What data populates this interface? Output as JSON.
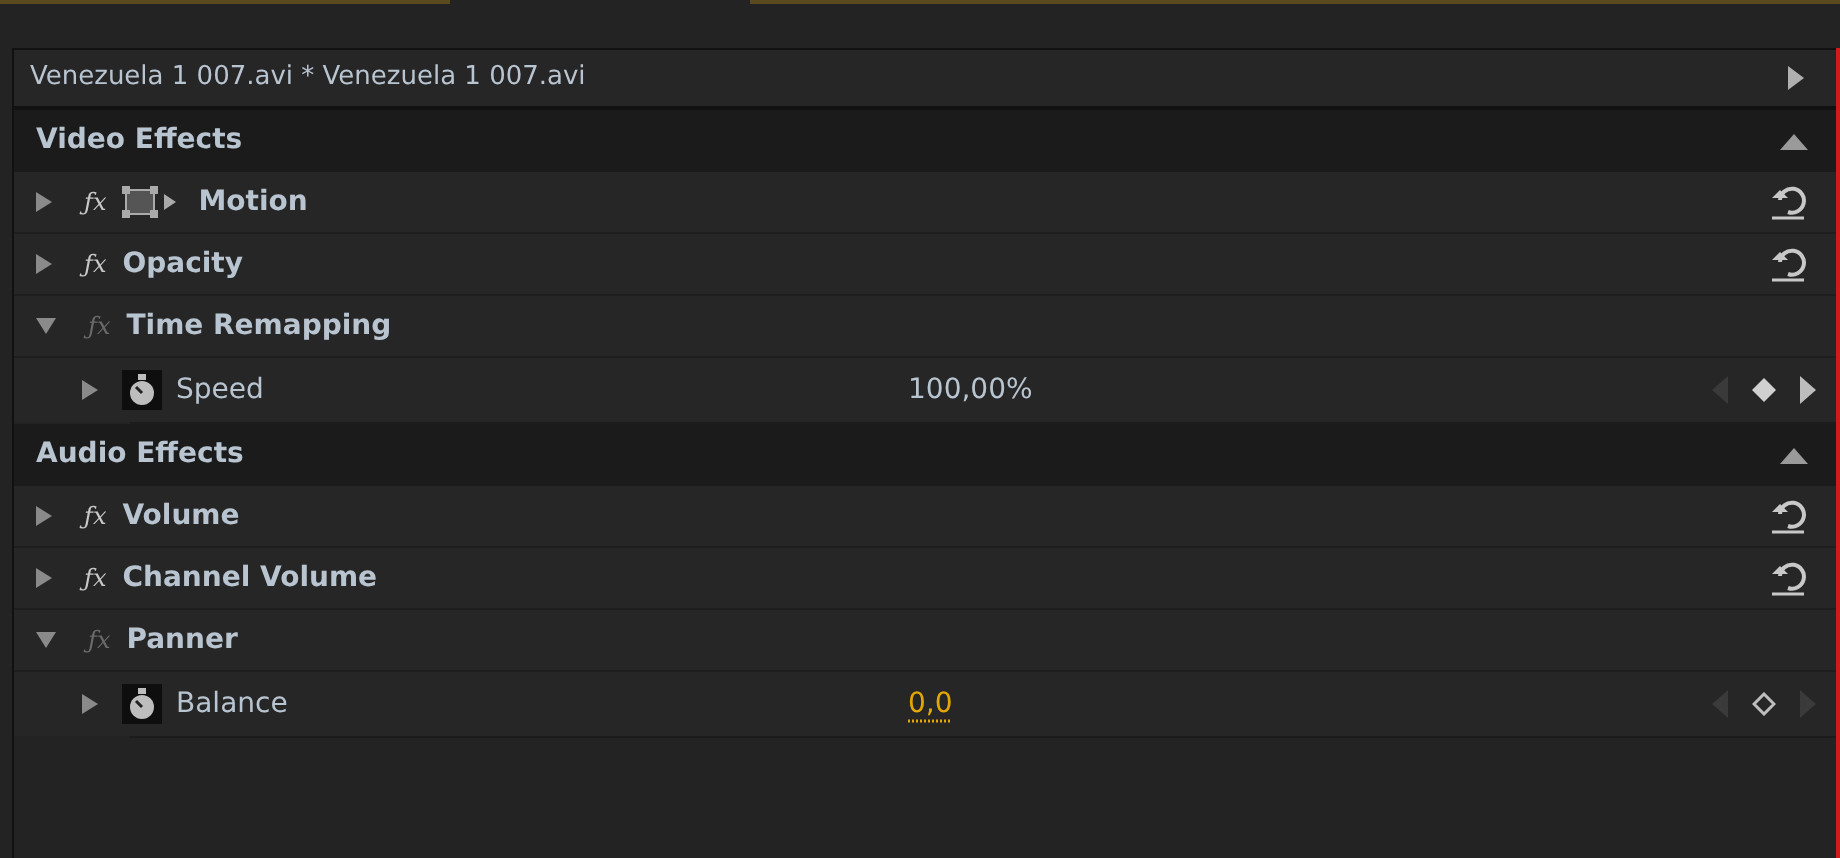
{
  "clip_header": {
    "title": "Venezuela 1 007.avi * Venezuela 1 007.avi"
  },
  "sections": [
    {
      "title": "Video Effects",
      "expanded": true,
      "effects": [
        {
          "name": "Motion",
          "fx": "ƒx",
          "expanded": false,
          "fx_enabled": true,
          "transform_icon": true,
          "resettable": true
        },
        {
          "name": "Opacity",
          "fx": "ƒx",
          "expanded": false,
          "fx_enabled": true,
          "transform_icon": false,
          "resettable": true
        },
        {
          "name": "Time Remapping",
          "fx": "ƒx",
          "expanded": true,
          "fx_enabled": false,
          "transform_icon": false,
          "resettable": false,
          "params": [
            {
              "name": "Speed",
              "value": "100,00%",
              "scrubbable": false,
              "keyframe": true,
              "next_keyframe": true
            }
          ]
        }
      ]
    },
    {
      "title": "Audio Effects",
      "expanded": true,
      "effects": [
        {
          "name": "Volume",
          "fx": "ƒx",
          "expanded": false,
          "fx_enabled": true,
          "transform_icon": false,
          "resettable": true
        },
        {
          "name": "Channel Volume",
          "fx": "ƒx",
          "expanded": false,
          "fx_enabled": true,
          "transform_icon": false,
          "resettable": true
        },
        {
          "name": "Panner",
          "fx": "ƒx",
          "expanded": true,
          "fx_enabled": false,
          "transform_icon": false,
          "resettable": false,
          "params": [
            {
              "name": "Balance",
              "value": "0,0",
              "scrubbable": true,
              "keyframe": false,
              "next_keyframe": false
            }
          ]
        }
      ]
    }
  ]
}
